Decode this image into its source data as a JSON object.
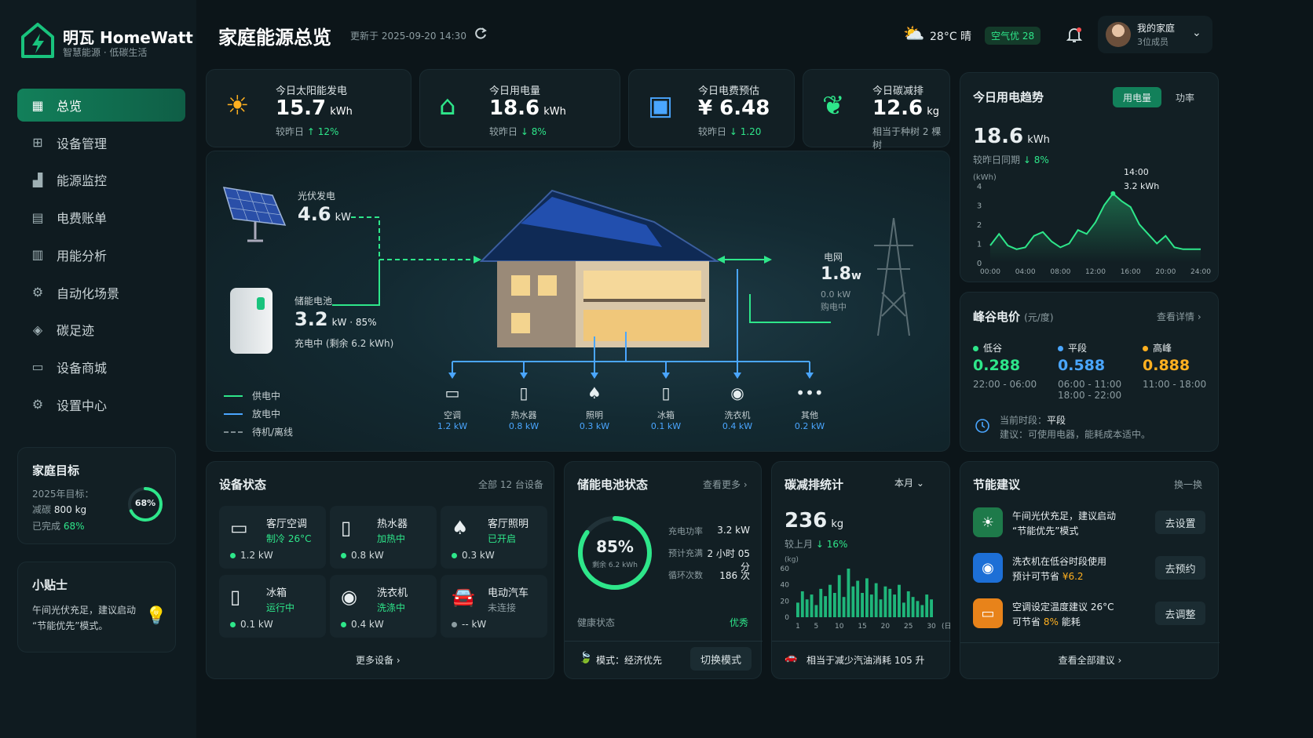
{
  "brand": {
    "name": "明瓦 HomeWatt",
    "tagline": "智慧能源 · 低碳生活"
  },
  "nav": [
    {
      "label": "总览",
      "icon": "grid-icon",
      "active": true
    },
    {
      "label": "设备管理",
      "icon": "devices-icon"
    },
    {
      "label": "能源监控",
      "icon": "chart-bar-icon"
    },
    {
      "label": "电费账单",
      "icon": "bill-icon"
    },
    {
      "label": "用能分析",
      "icon": "analytics-icon"
    },
    {
      "label": "自动化场景",
      "icon": "automation-icon"
    },
    {
      "label": "碳足迹",
      "icon": "footprint-icon"
    },
    {
      "label": "设备商城",
      "icon": "store-icon"
    },
    {
      "label": "设置中心",
      "icon": "settings-icon"
    }
  ],
  "goal": {
    "title": "家庭目标",
    "line1": "2025年目标：",
    "line2_label": "减碳",
    "line2_value": "800 kg",
    "line3_label": "已完成",
    "line3_value": "68%",
    "percent": 68,
    "ring_label": "68%"
  },
  "tip": {
    "title": "小贴士",
    "text1": "午间光伏充足，建议启动",
    "text2": "“节能优先”模式。"
  },
  "header": {
    "title": "家庭能源总览",
    "updated": "更新于 2025-09-20 14:30",
    "weather": "28°C 晴",
    "aqi": "空气优 28",
    "user_name": "我的家庭",
    "user_sub": "3位成员"
  },
  "kpis": [
    {
      "label": "今日太阳能发电",
      "value": "15.7",
      "unit": "kWh",
      "sub_label": "较昨日",
      "sub_value": "↑ 12%",
      "icon": "sun-icon"
    },
    {
      "label": "今日用电量",
      "value": "18.6",
      "unit": "kWh",
      "sub_label": "较昨日",
      "sub_value": "↓ 8%",
      "icon": "house-icon"
    },
    {
      "label": "今日电费预估",
      "value": "¥ 6.48",
      "unit": "",
      "sub_label": "较昨日",
      "sub_value": "↓ 1.20",
      "icon": "wallet-icon"
    },
    {
      "label": "今日碳减排",
      "value": "12.6",
      "unit": "kg",
      "sub_label": "相当于种树 2 棵树",
      "sub_value": "",
      "icon": "leaf-icon"
    }
  ],
  "flow": {
    "pv_label": "光伏发电",
    "pv_value": "4.6",
    "pv_unit": "kW",
    "battery_label": "储能电池",
    "battery_value": "3.2",
    "battery_unit": "kW · 85%",
    "battery_sub": "充电中 (剩余 6.2 kWh)",
    "grid_label": "电网",
    "grid_value": "1.8",
    "grid_unit": "w",
    "grid_sub1": "0.0 kW",
    "grid_sub2": "购电中",
    "legend": [
      {
        "label": "供电中",
        "color": "#2ee68a"
      },
      {
        "label": "放电中",
        "color": "#4aa6ff"
      },
      {
        "label": "待机/离线",
        "color": "#7d8b90"
      }
    ],
    "appliances": [
      {
        "name": "空调",
        "power": "1.2 kW",
        "icon": "ac-icon"
      },
      {
        "name": "热水器",
        "power": "0.8 kW",
        "icon": "water-heater-icon"
      },
      {
        "name": "照明",
        "power": "0.3 kW",
        "icon": "lamp-icon"
      },
      {
        "name": "冰箱",
        "power": "0.1 kW",
        "icon": "fridge-icon"
      },
      {
        "name": "洗衣机",
        "power": "0.4 kW",
        "icon": "washer-icon"
      },
      {
        "name": "其他",
        "power": "0.2 kW",
        "icon": "more-icon"
      }
    ]
  },
  "trend": {
    "title": "今日用电趋势",
    "tab1": "用电量",
    "tab2": "功率",
    "value": "18.6",
    "unit": "kWh",
    "sub_label": "较昨日同期",
    "sub_value": "↓ 8%",
    "y_unit": "(kWh)",
    "tooltip_time": "14:00",
    "tooltip_value": "3.2 kWh"
  },
  "chart_data": [
    {
      "type": "area",
      "title": "今日用电趋势",
      "ylabel": "(kWh)",
      "xlabel": "",
      "x": [
        "00:00",
        "01:00",
        "02:00",
        "03:00",
        "04:00",
        "05:00",
        "06:00",
        "07:00",
        "08:00",
        "09:00",
        "10:00",
        "11:00",
        "12:00",
        "13:00",
        "14:00",
        "15:00",
        "16:00",
        "17:00",
        "18:00",
        "19:00",
        "20:00",
        "21:00",
        "22:00",
        "23:00",
        "24:00"
      ],
      "values": [
        0.9,
        1.5,
        0.9,
        0.7,
        0.8,
        1.4,
        1.6,
        1.1,
        0.8,
        1.0,
        1.7,
        1.5,
        2.1,
        3.0,
        3.6,
        3.2,
        2.9,
        2.0,
        1.5,
        1.0,
        1.4,
        0.8,
        0.7,
        0.7,
        0.7
      ],
      "ylim": [
        0,
        4
      ],
      "yticks": [
        0,
        1,
        2,
        3,
        4
      ],
      "xticks": [
        "00:00",
        "04:00",
        "08:00",
        "12:00",
        "16:00",
        "20:00",
        "24:00"
      ],
      "grid": false
    },
    {
      "type": "bar",
      "title": "碳减排统计",
      "ylabel": "(kg)",
      "xlabel": "(日)",
      "categories": [
        "1",
        "2",
        "3",
        "4",
        "5",
        "6",
        "7",
        "8",
        "9",
        "10",
        "11",
        "12",
        "13",
        "14",
        "15",
        "16",
        "17",
        "18",
        "19",
        "20",
        "21",
        "22",
        "23",
        "24",
        "25",
        "26",
        "27",
        "28",
        "29",
        "30"
      ],
      "values": [
        18,
        32,
        22,
        28,
        15,
        35,
        26,
        40,
        30,
        52,
        25,
        60,
        38,
        45,
        30,
        48,
        28,
        42,
        22,
        38,
        35,
        28,
        40,
        18,
        32,
        25,
        20,
        15,
        28,
        22
      ],
      "ylim": [
        0,
        60
      ],
      "yticks": [
        0,
        20,
        40,
        60
      ],
      "xticks": [
        "1",
        "5",
        "10",
        "15",
        "20",
        "25",
        "30"
      ],
      "grid": false
    }
  ],
  "tariff": {
    "title": "峰谷电价",
    "unit": "(元/度)",
    "link": "查看详情",
    "items": [
      {
        "label": "低谷",
        "price": "0.288",
        "time1": "22:00 - 06:00",
        "time2": "",
        "color": "#2ee68a"
      },
      {
        "label": "平段",
        "price": "0.588",
        "time1": "06:00 - 11:00",
        "time2": "18:00 - 22:00",
        "color": "#4aa6ff"
      },
      {
        "label": "高峰",
        "price": "0.888",
        "time1": "11:00 - 18:00",
        "time2": "",
        "color": "#ffb020"
      }
    ],
    "current_label": "当前时段：",
    "current_value": "平段",
    "advice_label": "建议：",
    "advice": "可使用电器，能耗成本适中。"
  },
  "devices": {
    "title": "设备状态",
    "count": "全部 12 台设备",
    "more": "更多设备",
    "items": [
      {
        "name": "客厅空调",
        "state": "制冷 26°C",
        "power": "1.2 kW",
        "on": true,
        "icon": "ac-icon"
      },
      {
        "name": "热水器",
        "state": "加热中",
        "power": "0.8 kW",
        "on": true,
        "icon": "water-heater-icon"
      },
      {
        "name": "客厅照明",
        "state": "已开启",
        "power": "0.3 kW",
        "on": true,
        "icon": "lamp-icon"
      },
      {
        "name": "冰箱",
        "state": "运行中",
        "power": "0.1 kW",
        "on": true,
        "icon": "fridge-icon"
      },
      {
        "name": "洗衣机",
        "state": "洗涤中",
        "power": "0.4 kW",
        "on": true,
        "icon": "washer-icon"
      },
      {
        "name": "电动汽车",
        "state": "未连接",
        "power": "-- kW",
        "on": false,
        "icon": "car-icon"
      }
    ]
  },
  "battery": {
    "title": "储能电池状态",
    "more": "查看更多",
    "percent": 85,
    "percent_label": "85%",
    "remain": "剩余 6.2 kWh",
    "rows": [
      {
        "label": "充电功率",
        "value": "3.2 kW"
      },
      {
        "label": "预计充满",
        "value": "2 小时 05 分"
      },
      {
        "label": "循环次数",
        "value": "186 次"
      }
    ],
    "health_label": "健康状态",
    "health_value": "优秀",
    "mode_label": "模式：经济优先",
    "mode_btn": "切换模式"
  },
  "carbon": {
    "title": "碳减排统计",
    "period": "本月",
    "value": "236",
    "unit": "kg",
    "sub_label": "较上月",
    "sub_value": "↓ 16%",
    "y_unit": "(kg)",
    "x_unit": "(日)",
    "footer": "相当于减少汽油消耗 105 升"
  },
  "saving": {
    "title": "节能建议",
    "refresh": "换一换",
    "all": "查看全部建议",
    "items": [
      {
        "line1": "午间光伏充足，建议启动",
        "line2": "“节能优先”模式",
        "action": "去设置",
        "icon": "sun-icon",
        "color": "#1e7a4a"
      },
      {
        "line1": "洗衣机在低谷时段使用",
        "line2_pre": "预计可节省",
        "line2_hl": "¥6.2",
        "action": "去预约",
        "icon": "washer-icon",
        "color": "#1d6fd6"
      },
      {
        "line1": "空调设定温度建议 26°C",
        "line2_pre": "可节省",
        "line2_hl": "8%",
        "line2_post": "能耗",
        "action": "去调整",
        "icon": "ac-icon",
        "color": "#e8831a"
      }
    ]
  }
}
